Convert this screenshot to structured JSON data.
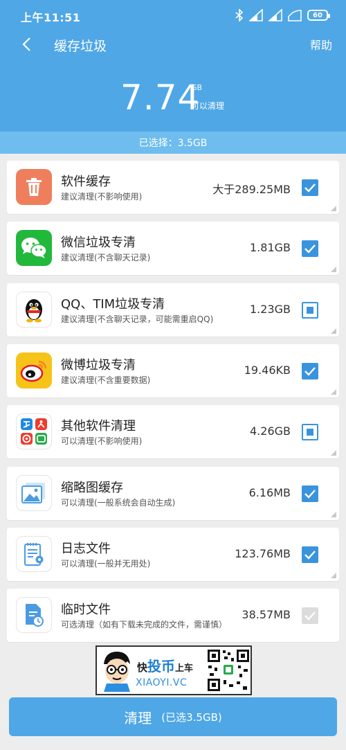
{
  "status_bar": {
    "time": "上午11:51",
    "battery": "60"
  },
  "nav": {
    "title": "缓存垃圾",
    "help": "帮助"
  },
  "summary": {
    "size": "7.74",
    "unit": "GB",
    "caption": "可以清理"
  },
  "selected_bar": {
    "text": "已选择：3.5GB"
  },
  "items": [
    {
      "title": "软件缓存",
      "subtitle": "建议清理(不影响使用)",
      "size": "大于289.25MB",
      "state": "checked",
      "icon": "trash-icon"
    },
    {
      "title": "微信垃圾专清",
      "subtitle": "建议清理(不含聊天记录)",
      "size": "1.81GB",
      "state": "checked",
      "icon": "wechat-icon"
    },
    {
      "title": "QQ、TIM垃圾专清",
      "subtitle": "建议清理(不含聊天记录，可能需重启QQ)",
      "size": "1.23GB",
      "state": "partial",
      "icon": "qq-penguin-icon"
    },
    {
      "title": "微博垃圾专清",
      "subtitle": "建议清理(不含重要数据)",
      "size": "19.46KB",
      "state": "checked",
      "icon": "weibo-icon"
    },
    {
      "title": "其他软件清理",
      "subtitle": "可以清理(不影响使用)",
      "size": "4.26GB",
      "state": "partial",
      "icon": "app-grid-icon"
    },
    {
      "title": "缩略图缓存",
      "subtitle": "可以清理(一般系统会自动生成)",
      "size": "6.16MB",
      "state": "checked",
      "icon": "image-icon"
    },
    {
      "title": "日志文件",
      "subtitle": "可以清理(一般并无用处)",
      "size": "123.76MB",
      "state": "checked",
      "icon": "log-file-icon"
    },
    {
      "title": "临时文件",
      "subtitle": "可选清理（如有下载未完成的文件，需谨慎）",
      "size": "38.57MB",
      "state": "disabled",
      "icon": "temp-file-icon"
    }
  ],
  "watermark": {
    "line1_prefix": "快",
    "line1_big": "投币",
    "line1_suffix": "上车",
    "line2": "XIAOYI.VC"
  },
  "action": {
    "label": "清理",
    "sub": "(已选3.5GB)"
  },
  "colors": {
    "primary": "#4fa7e6",
    "selected_bar": "#6ebdee",
    "checkbox": "#3a94dd",
    "background": "#ededed"
  }
}
